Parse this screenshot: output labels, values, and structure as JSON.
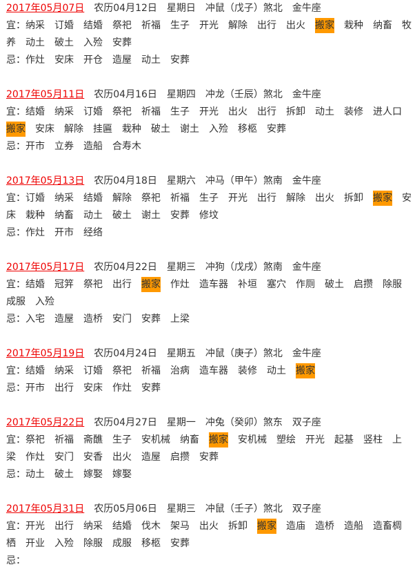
{
  "labels": {
    "yi": "宜：",
    "ji": "忌："
  },
  "highlight_word": "搬家",
  "colors": {
    "date": "#ee0000",
    "highlight": "#ff9900",
    "text": "#333333"
  },
  "entries": [
    {
      "date": "2017年05月07日",
      "lunar": "农历04月12日",
      "weekday": "星期日",
      "chong": "冲鼠（戊子）煞北",
      "zodiac": "金牛座",
      "yi": [
        "纳采",
        "订婚",
        "结婚",
        "祭祀",
        "祈福",
        "生子",
        "开光",
        "解除",
        "出行",
        "出火",
        "搬家",
        "栽种",
        "纳畜",
        "牧养",
        "动土",
        "破土",
        "入殓",
        "安葬"
      ],
      "ji": [
        "作灶",
        "安床",
        "开仓",
        "造屋",
        "动土",
        "安葬"
      ]
    },
    {
      "date": "2017年05月11日",
      "lunar": "农历04月16日",
      "weekday": "星期四",
      "chong": "冲龙（壬辰）煞北",
      "zodiac": "金牛座",
      "yi": [
        "结婚",
        "纳采",
        "订婚",
        "祭祀",
        "祈福",
        "生子",
        "开光",
        "出火",
        "出行",
        "拆卸",
        "动土",
        "装修",
        "进人口",
        "搬家",
        "安床",
        "解除",
        "挂匾",
        "栽种",
        "破土",
        "谢土",
        "入殓",
        "移柩",
        "安葬"
      ],
      "ji": [
        "开市",
        "立券",
        "造船",
        "合寿木"
      ]
    },
    {
      "date": "2017年05月13日",
      "lunar": "农历04月18日",
      "weekday": "星期六",
      "chong": "冲马（甲午）煞南",
      "zodiac": "金牛座",
      "yi": [
        "订婚",
        "纳采",
        "结婚",
        "解除",
        "祭祀",
        "祈福",
        "生子",
        "开光",
        "出行",
        "解除",
        "出火",
        "拆卸",
        "搬家",
        "安床",
        "栽种",
        "纳畜",
        "动土",
        "破土",
        "谢土",
        "安葬",
        "修坟"
      ],
      "ji": [
        "作灶",
        "开市",
        "经络"
      ]
    },
    {
      "date": "2017年05月17日",
      "lunar": "农历04月22日",
      "weekday": "星期三",
      "chong": "冲狗（戊戌）煞南",
      "zodiac": "金牛座",
      "yi": [
        "结婚",
        "冠笄",
        "祭祀",
        "出行",
        "搬家",
        "作灶",
        "造车器",
        "补垣",
        "塞穴",
        "作厕",
        "破土",
        "启攒",
        "除服",
        "成服",
        "入殓"
      ],
      "ji": [
        "入宅",
        "造屋",
        "造桥",
        "安门",
        "安葬",
        "上梁"
      ]
    },
    {
      "date": "2017年05月19日",
      "lunar": "农历04月24日",
      "weekday": "星期五",
      "chong": "冲鼠（庚子）煞北",
      "zodiac": "金牛座",
      "yi": [
        "结婚",
        "纳采",
        "订婚",
        "祭祀",
        "祈福",
        "治病",
        "造车器",
        "装修",
        "动土",
        "搬家"
      ],
      "ji": [
        "开市",
        "出行",
        "安床",
        "作灶",
        "安葬"
      ]
    },
    {
      "date": "2017年05月22日",
      "lunar": "农历04月27日",
      "weekday": "星期一",
      "chong": "冲兔（癸卯）煞东",
      "zodiac": "双子座",
      "yi": [
        "祭祀",
        "祈福",
        "斋醮",
        "生子",
        "安机械",
        "纳畜",
        "搬家",
        "安机械",
        "塑绘",
        "开光",
        "起基",
        "竖柱",
        "上梁",
        "作灶",
        "安门",
        "安香",
        "出火",
        "造屋",
        "启攒",
        "安葬"
      ],
      "ji": [
        "动土",
        "破土",
        "嫁娶",
        "嫁娶"
      ]
    },
    {
      "date": "2017年05月31日",
      "lunar": "农历05月06日",
      "weekday": "星期三",
      "chong": "冲鼠（壬子）煞北",
      "zodiac": "双子座",
      "yi": [
        "开光",
        "出行",
        "纳采",
        "结婚",
        "伐木",
        "架马",
        "出火",
        "拆卸",
        "搬家",
        "造庙",
        "造桥",
        "造船",
        "造畜椆栖",
        "开业",
        "入殓",
        "除服",
        "成服",
        "移柩",
        "安葬"
      ],
      "ji": []
    }
  ]
}
